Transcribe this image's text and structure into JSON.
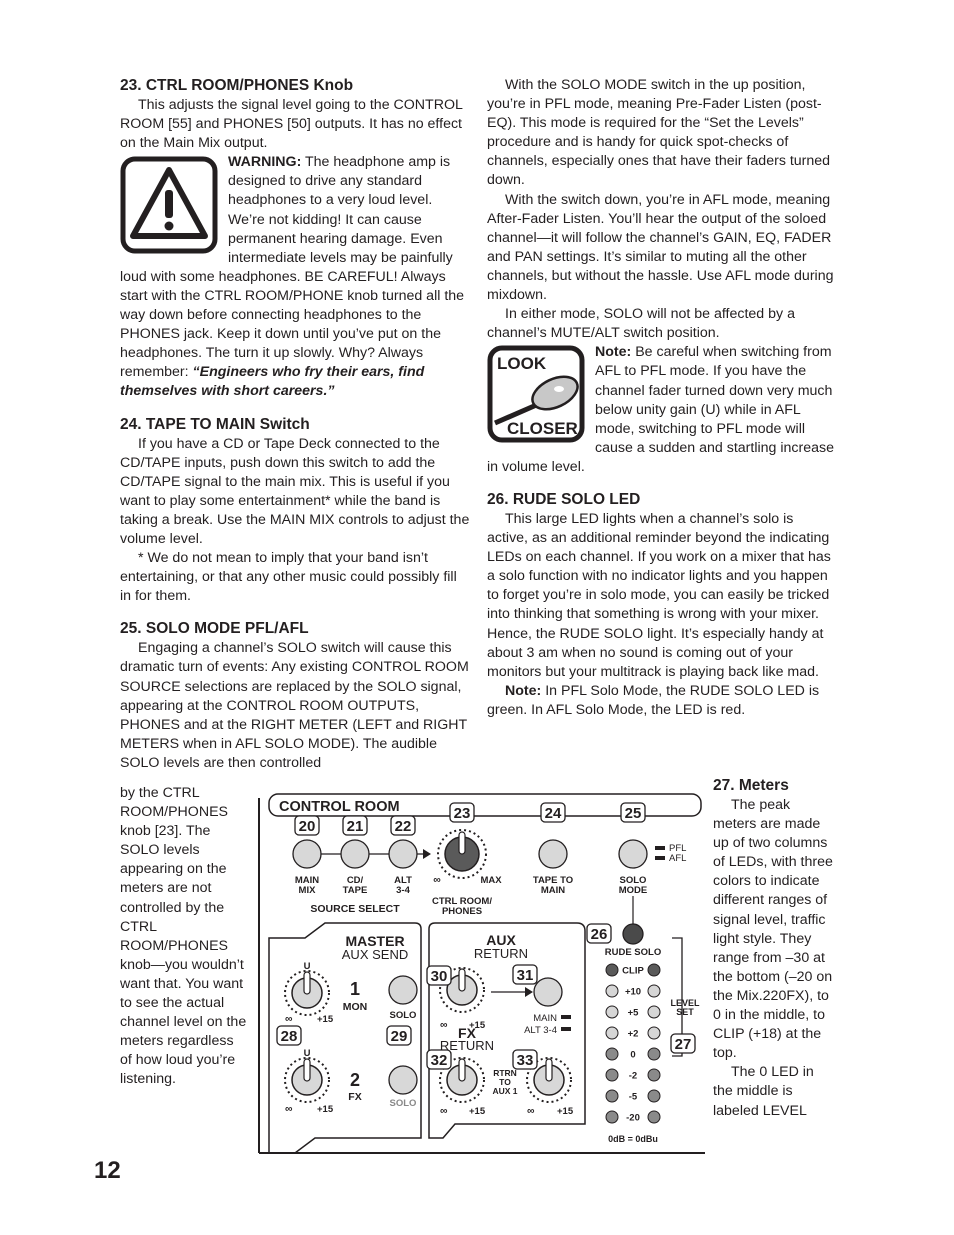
{
  "page_number": "12",
  "left_column": {
    "s23": {
      "heading": "23. CTRL ROOM/PHONES Knob",
      "intro": "This adjusts the signal level going to the CONTROL ROOM [55] and PHONES [50] outputs. It has no effect on the Main Mix output.",
      "warning_label": "WARNING:",
      "warning_text": " The headphone amp is designed to drive any standard headphones to a very loud level. We’re not kidding! It can cause permanent hearing damage. Even intermediate levels may be painfully loud with some headphones. BE CAREFUL! Always start with the CTRL ROOM/PHONE knob turned all the way down before connecting headphones to the PHONES jack. Keep it down until you’ve put on the headphones. The turn it up slowly. Why? Always remember: ",
      "quote": "“Engineers who fry their ears, find themselves with short careers.”"
    },
    "s24": {
      "heading": "24. TAPE TO MAIN Switch",
      "p1": "If you have a CD or Tape Deck connected to the CD/TAPE inputs, push down this switch to add the CD/TAPE signal to the main mix. This is useful if you want to play some entertainment* while the band is taking a break. Use the MAIN MIX controls to adjust the volume level.",
      "p2": "* We do not mean to imply that your band isn’t entertaining, or that any other music could possibly fill in for them."
    },
    "s25": {
      "heading": "25. SOLO MODE PFL/AFL",
      "p1": "Engaging a channel’s SOLO switch will cause this dramatic turn of events: Any existing CONTROL ROOM SOURCE selections are replaced by the SOLO signal, appearing at the CONTROL ROOM OUTPUTS, PHONES and at the RIGHT METER (LEFT and RIGHT METERS when in AFL SOLO MODE). The audible SOLO levels are then controlled",
      "p1_cont": "by the CTRL ROOM/PHONES knob [23]. The SOLO levels appearing on the meters are not controlled by the CTRL ROOM/PHONES knob—you wouldn’t want that. You want to see the actual channel level on the meters regardless of how loud you’re listening."
    }
  },
  "right_column": {
    "p_pfl": "With the SOLO MODE switch in the up position, you’re in PFL mode, meaning Pre-Fader Listen (post-EQ). This mode is required for the “Set the Levels” procedure and is handy for quick spot-checks of channels, especially ones that have their faders turned down.",
    "p_afl": "With the switch down, you’re in AFL mode, meaning After-Fader Listen. You’ll hear the output of the soloed channel—it will follow the channel’s GAIN, EQ, FADER and PAN settings. It’s similar to muting all the other channels, but without the hassle. Use AFL mode during mixdown.",
    "p_either": "In either mode, SOLO will not be affected by a channel’s MUTE/ALT switch position.",
    "look_closer": {
      "top": "LOOK",
      "bottom": "CLOSER"
    },
    "note_label": "Note:",
    "note_text": " Be careful when switching from AFL to PFL mode. If you have the channel fader turned down very much below unity gain (U) while in AFL mode, switching to PFL mode will cause a sudden and startling increase in volume level.",
    "s26": {
      "heading": "26. RUDE SOLO LED",
      "p1": "This large LED lights when a channel’s solo is active, as an additional reminder beyond the indicating LEDs on each channel. If you work on a mixer that has a solo function with no indicator lights and you happen to forget you’re in solo mode, you can easily be tricked into thinking that something is wrong with your mixer. Hence, the RUDE SOLO light. It’s especially handy at about 3 am when no sound is coming out of your monitors but your multitrack is playing back like mad.",
      "note_label": "Note:",
      "note_text": " In PFL Solo Mode, the RUDE SOLO LED is green. In AFL Solo Mode, the LED is red."
    },
    "s27": {
      "heading": "27. Meters",
      "p1": "The peak meters are made up of two columns of LEDs, with three colors to indicate different ranges of signal level, traffic light style. They range from –30 at the bottom (–20 on the Mix.220FX), to 0 in the middle, to CLIP (+18) at the top.",
      "p2": "The 0 LED in the middle is labeled LEVEL"
    }
  },
  "diagram": {
    "control_room_title": "CONTROL ROOM",
    "callouts": [
      "20",
      "21",
      "22",
      "23",
      "24",
      "25",
      "26",
      "27",
      "28",
      "29",
      "30",
      "31",
      "32",
      "33"
    ],
    "source_buttons": [
      {
        "label1": "MAIN",
        "label2": "MIX"
      },
      {
        "label1": "CD/",
        "label2": "TAPE"
      },
      {
        "label1": "ALT",
        "label2": "3-4"
      }
    ],
    "source_select_label": "SOURCE SELECT",
    "ctrl_room_knob": {
      "min": "∞",
      "max": "MAX",
      "label1": "CTRL ROOM/",
      "label2": "PHONES"
    },
    "tape_to_main": {
      "label1": "TAPE TO",
      "label2": "MAIN"
    },
    "solo_mode": {
      "label1": "SOLO",
      "label2": "MODE",
      "pfl": "PFL",
      "afl": "AFL"
    },
    "master_aux": {
      "title": "MASTER",
      "subtitle": "AUX SEND",
      "knob1": {
        "num": "1",
        "name": "MON",
        "u": "U",
        "min": "∞",
        "max": "+15"
      },
      "knob2": {
        "num": "2",
        "name": "FX",
        "u": "U",
        "min": "∞",
        "max": "+15"
      },
      "solo": "SOLO"
    },
    "aux_return": {
      "title": "AUX",
      "subtitle": "RETURN",
      "fx_title": "FX",
      "fx_subtitle": "RETURN",
      "min": "∞",
      "max": "+15",
      "main_label": "MAIN",
      "alt_label": "ALT 3-4",
      "rtrn_to_aux": [
        "RTRN",
        "TO",
        "AUX 1"
      ]
    },
    "meter": {
      "rude_solo_label": "RUDE SOLO",
      "levels": [
        "CLIP",
        "+10",
        "+5",
        "+2",
        "0",
        "-2",
        "-5",
        "-20"
      ],
      "level_set": [
        "LEVEL",
        "SET"
      ],
      "footer": "0dB = 0dBu"
    }
  },
  "colors": {
    "text": "#231f20",
    "button_fill": "#d8d8d8",
    "knob_dark": "#5a5a5a",
    "led_dark": "#6e6e6e",
    "led_light": "#d6d6d6"
  }
}
